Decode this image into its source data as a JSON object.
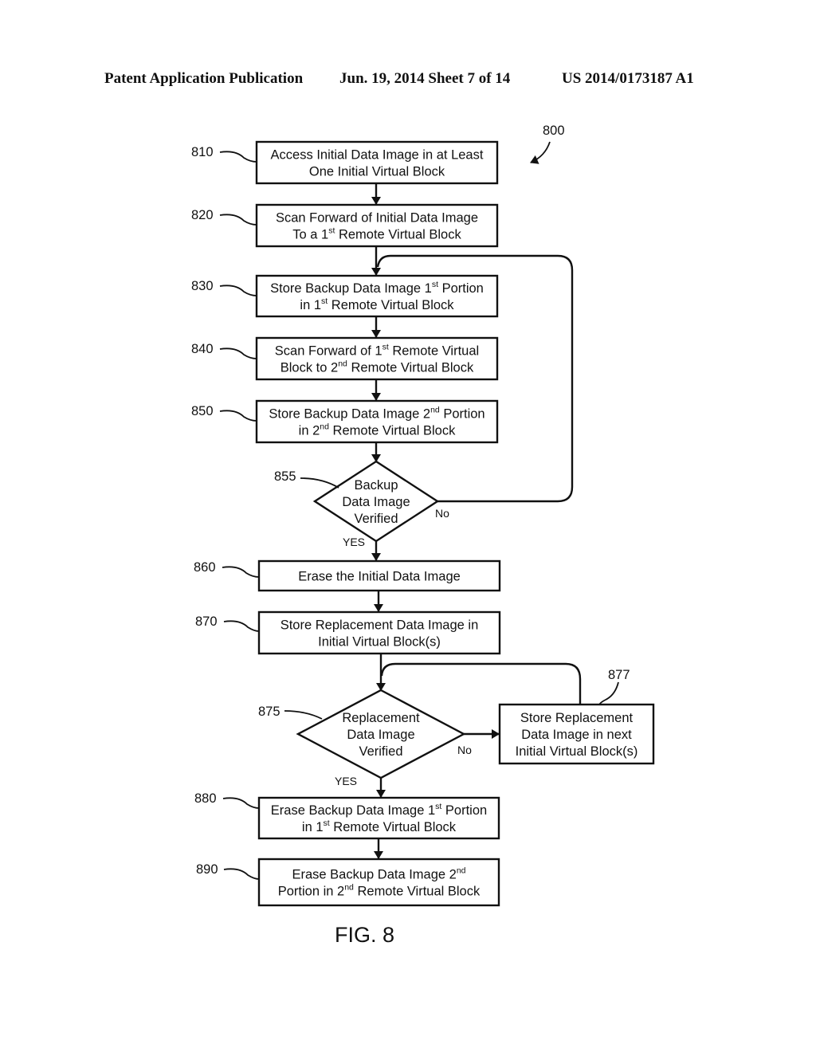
{
  "header": {
    "publication": "Patent Application Publication",
    "date_sheet": "Jun. 19, 2014  Sheet 7 of 14",
    "number": "US 2014/0173187 A1"
  },
  "figure": {
    "ref": "800",
    "caption": "FIG. 8"
  },
  "steps": [
    {
      "ref": "810",
      "lines": [
        [
          "Access Initial Data Image in at Least",
          "",
          ""
        ],
        [
          "One Initial Virtual Block",
          "",
          ""
        ]
      ]
    },
    {
      "ref": "820",
      "lines": [
        [
          "Scan Forward of Initial Data Image",
          "",
          ""
        ],
        [
          "To a 1",
          "st",
          " Remote Virtual Block"
        ]
      ]
    },
    {
      "ref": "830",
      "lines": [
        [
          "Store Backup Data Image 1",
          "st",
          " Portion"
        ],
        [
          "in 1",
          "st",
          " Remote Virtual Block"
        ]
      ]
    },
    {
      "ref": "840",
      "lines": [
        [
          "Scan Forward of 1",
          "st",
          " Remote Virtual"
        ],
        [
          "Block to 2",
          "nd",
          " Remote Virtual Block"
        ]
      ]
    },
    {
      "ref": "850",
      "lines": [
        [
          "Store Backup Data Image 2",
          "nd",
          " Portion"
        ],
        [
          "in 2",
          "nd",
          " Remote Virtual Block"
        ]
      ]
    },
    {
      "ref": "860",
      "lines": [
        [
          "Erase the Initial Data Image",
          "",
          ""
        ]
      ]
    },
    {
      "ref": "870",
      "lines": [
        [
          "Store Replacement Data Image in",
          "",
          ""
        ],
        [
          "Initial Virtual Block(s)",
          "",
          ""
        ]
      ]
    },
    {
      "ref": "877",
      "lines": [
        [
          "Store Replacement",
          "",
          ""
        ],
        [
          "Data Image in next",
          "",
          ""
        ],
        [
          "Initial Virtual Block(s)",
          "",
          ""
        ]
      ]
    },
    {
      "ref": "880",
      "lines": [
        [
          "Erase Backup Data Image 1",
          "st",
          " Portion"
        ],
        [
          "in 1",
          "st",
          " Remote Virtual Block"
        ]
      ]
    },
    {
      "ref": "890",
      "lines": [
        [
          "Erase Backup Data Image 2",
          "nd",
          ""
        ],
        [
          "Portion in 2",
          "nd",
          " Remote Virtual Block"
        ]
      ]
    }
  ],
  "decisions": [
    {
      "ref": "855",
      "lines": [
        "Backup",
        "Data Image",
        "Verified"
      ],
      "yes_label": "YES",
      "no_label": "No"
    },
    {
      "ref": "875",
      "lines": [
        "Replacement",
        "Data Image",
        "Verified"
      ],
      "yes_label": "YES",
      "no_label": "No"
    }
  ]
}
